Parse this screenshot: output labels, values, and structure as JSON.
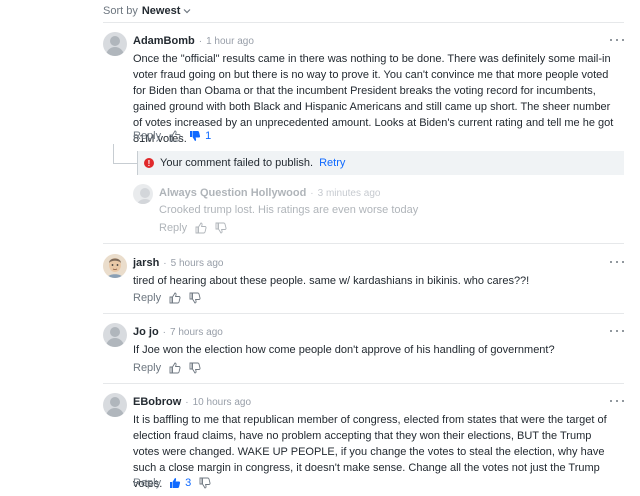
{
  "sort": {
    "label": "Sort by",
    "value": "Newest"
  },
  "comments": [
    {
      "author": "AdamBomb",
      "time": "1 hour ago",
      "text": "Once the \"official\" results came in there was nothing to be done. There was definitely some mail-in voter fraud going on but there is no way to prove it. You can't convince me that more people voted for Biden than Obama or that the incumbent President breaks the voting record for incumbents, gained ground with both Black and Hispanic Americans and still came up short. The sheer number of votes increased by an unprecedented amount. Looks at Biden's current rating and tell me he got 81M votes.",
      "reply": "Reply",
      "dislikes": "1"
    },
    {
      "author": "jarsh",
      "time": "5 hours ago",
      "text": "tired of hearing about these people. same w/ kardashians in bikinis. who cares??!",
      "reply": "Reply"
    },
    {
      "author": "Jo jo",
      "time": "7 hours ago",
      "text": "If Joe won the election how come people don't approve of his handling of government?",
      "reply": "Reply"
    },
    {
      "author": "EBobrow",
      "time": "10 hours ago",
      "text": "It is baffling to me that republican member of congress, elected from states that were the target of election fraud claims, have no problem accepting that they won their elections, BUT the Trump votes were changed. WAKE UP PEOPLE, if you change the votes to steal the election, why have such a close margin in congress, it doesn't make sense. Change all the votes not just the Trump votes.",
      "reply": "Reply",
      "likes": "3"
    }
  ],
  "failed": {
    "message": "Your comment failed to publish.",
    "retry": "Retry"
  },
  "pending_reply": {
    "author": "Always Question Hollywood",
    "time": "3 minutes ago",
    "text": "Crooked trump lost.  His ratings are even worse today",
    "reply": "Reply"
  },
  "colors": {
    "accent": "#0f69ff",
    "error": "#e0292b"
  },
  "separator": "·"
}
